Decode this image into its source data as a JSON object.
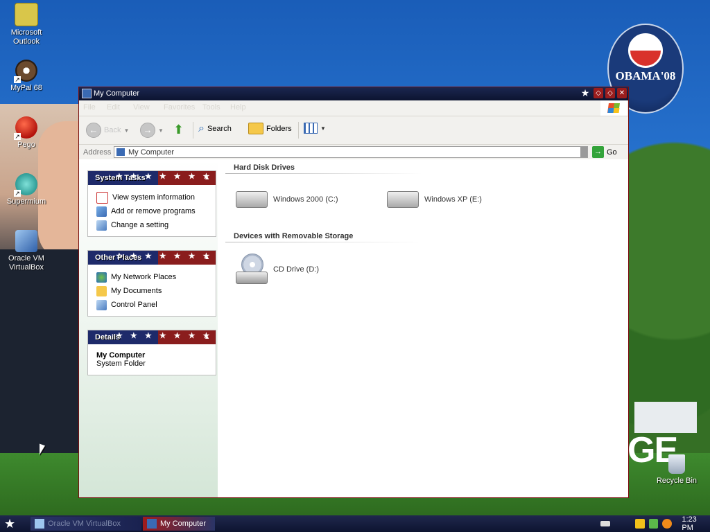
{
  "desktop": {
    "icons": [
      {
        "label": "Microsoft Outlook",
        "icon": "outlook-icon"
      },
      {
        "label": "MyPal 68",
        "icon": "mypal-icon"
      },
      {
        "label": "Pego",
        "icon": "pego-icon"
      },
      {
        "label": "Supermium",
        "icon": "supermium-icon"
      },
      {
        "label": "Oracle VM VirtualBox",
        "icon": "virtualbox-icon"
      }
    ],
    "badge_text": "OBAMA'08",
    "recycle_bin": "Recycle Bin",
    "wallpaper_text": "GE"
  },
  "window": {
    "title": "My Computer",
    "title_icon": "my-computer-icon",
    "menu": [
      "File",
      "Edit",
      "View",
      "Favorites",
      "Tools",
      "Help"
    ],
    "toolbar": {
      "back": "Back",
      "search": "Search",
      "folders": "Folders"
    },
    "address": {
      "label": "Address",
      "value": "My Computer",
      "go": "Go"
    },
    "panels": {
      "system_tasks": {
        "title": "System Tasks",
        "items": [
          "View system information",
          "Add or remove programs",
          "Change a setting"
        ]
      },
      "other_places": {
        "title": "Other Places",
        "items": [
          "My Network Places",
          "My Documents",
          "Control Panel"
        ]
      },
      "details": {
        "title": "Details",
        "name": "My Computer",
        "type": "System Folder"
      }
    },
    "sections": {
      "hard_disks": {
        "title": "Hard Disk Drives",
        "drives": [
          "Windows 2000 (C:)",
          "Windows XP (E:)"
        ]
      },
      "removable": {
        "title": "Devices with Removable Storage",
        "drives": [
          "CD Drive (D:)"
        ]
      }
    }
  },
  "taskbar": {
    "tasks": [
      "Oracle VM VirtualBox",
      "My Computer"
    ],
    "clock": "1:23 PM"
  },
  "colors": {
    "titlebar": "#0c1430",
    "panel_blue": "#1e2a6a",
    "panel_red": "#8a1d1d",
    "taskbar": "#0d1430"
  }
}
